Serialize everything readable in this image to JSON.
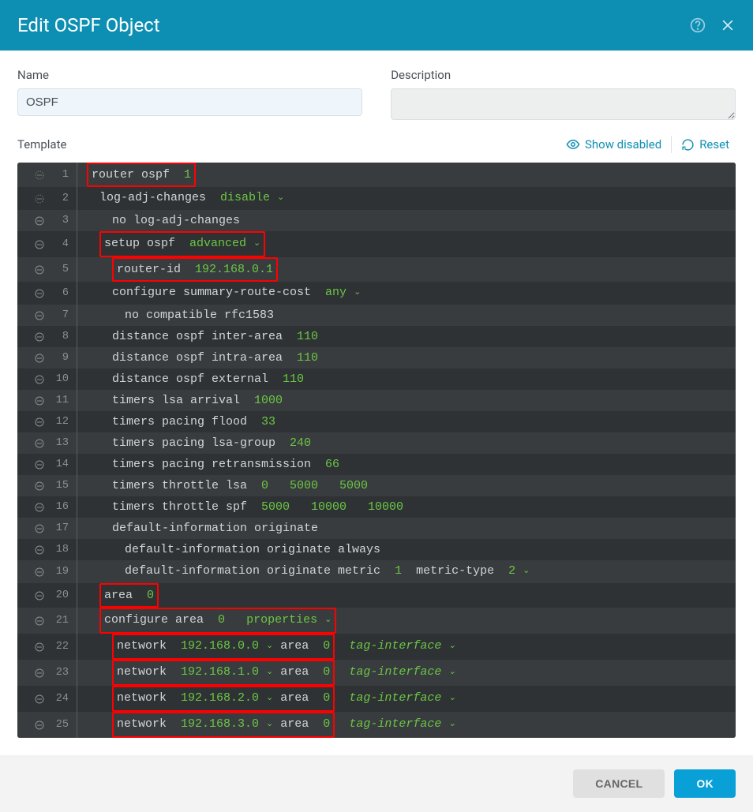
{
  "header": {
    "title": "Edit OSPF Object"
  },
  "form": {
    "name_label": "Name",
    "name_value": "OSPF",
    "desc_label": "Description",
    "desc_value": ""
  },
  "toolbar": {
    "template_label": "Template",
    "show_disabled": "Show disabled",
    "reset": "Reset"
  },
  "footer": {
    "cancel": "CANCEL",
    "ok": "OK"
  },
  "lines": {
    "l1": {
      "t": "router ospf  ",
      "v": "1",
      "red": true,
      "indent": 0,
      "dash": "dot"
    },
    "l2": {
      "t1": "log-adj-changes  ",
      "dd": "disable",
      "indent": 1,
      "dash": "dot"
    },
    "l3": {
      "t": "no log-adj-changes",
      "indent": 2,
      "dash": "circle"
    },
    "l4": {
      "t1": "setup ospf  ",
      "dd": "advanced",
      "red": true,
      "indent": 1,
      "dash": "circle"
    },
    "l5": {
      "t": "router-id  ",
      "v": "192.168.0.1",
      "red": true,
      "indent": 2,
      "dash": "circle"
    },
    "l6": {
      "t": "configure summary-route-cost  ",
      "dd": "any",
      "indent": 2,
      "dash": "circle"
    },
    "l7": {
      "t": "no compatible rfc1583",
      "indent": 3,
      "dash": "circle"
    },
    "l8": {
      "t": "distance ospf inter-area  ",
      "v": "110",
      "indent": 2,
      "dash": "circle"
    },
    "l9": {
      "t": "distance ospf intra-area  ",
      "v": "110",
      "indent": 2,
      "dash": "circle"
    },
    "l10": {
      "t": "distance ospf external  ",
      "v": "110",
      "indent": 2,
      "dash": "circle"
    },
    "l11": {
      "t": "timers lsa arrival  ",
      "v": "1000",
      "indent": 2,
      "dash": "circle"
    },
    "l12": {
      "t": "timers pacing flood  ",
      "v": "33",
      "indent": 2,
      "dash": "circle"
    },
    "l13": {
      "t": "timers pacing lsa-group  ",
      "v": "240",
      "indent": 2,
      "dash": "circle"
    },
    "l14": {
      "t": "timers pacing retransmission  ",
      "v": "66",
      "indent": 2,
      "dash": "circle"
    },
    "l15": {
      "t": "timers throttle lsa  ",
      "v": "0   5000   5000",
      "indent": 2,
      "dash": "circle"
    },
    "l16": {
      "t": "timers throttle spf  ",
      "v": "5000   10000   10000",
      "indent": 2,
      "dash": "circle"
    },
    "l17": {
      "t": "default-information originate",
      "indent": 2,
      "dash": "circle"
    },
    "l18": {
      "t": "default-information originate always",
      "indent": 3,
      "dash": "circle"
    },
    "l19": {
      "t": "default-information originate metric  ",
      "v": "1",
      "t2": "  metric-type  ",
      "dd": "2",
      "indent": 3,
      "dash": "circle"
    },
    "l20": {
      "t": "area  ",
      "v": "0",
      "red": true,
      "indent": 1,
      "dash": "circle"
    },
    "l21": {
      "t": "configure area  ",
      "v": "0",
      "gap": "   ",
      "dd": "properties",
      "red": true,
      "indent": 1,
      "dash": "circle"
    },
    "l22": {
      "t": "network  ",
      "v": "192.168.0.0",
      "t2": " area  ",
      "v2": "0",
      "red": true,
      "tg": "tag-interface",
      "indent": 2,
      "dash": "circle"
    },
    "l23": {
      "t": "network  ",
      "v": "192.168.1.0",
      "t2": " area  ",
      "v2": "0",
      "red": true,
      "tg": "tag-interface",
      "indent": 2,
      "dash": "circle"
    },
    "l24": {
      "t": "network  ",
      "v": "192.168.2.0",
      "t2": " area  ",
      "v2": "0",
      "red": true,
      "tg": "tag-interface",
      "indent": 2,
      "dash": "circle"
    },
    "l25": {
      "t": "network  ",
      "v": "192.168.3.0",
      "t2": " area  ",
      "v2": "0",
      "red": true,
      "tg": "tag-interface",
      "indent": 2,
      "dash": "circle"
    }
  }
}
